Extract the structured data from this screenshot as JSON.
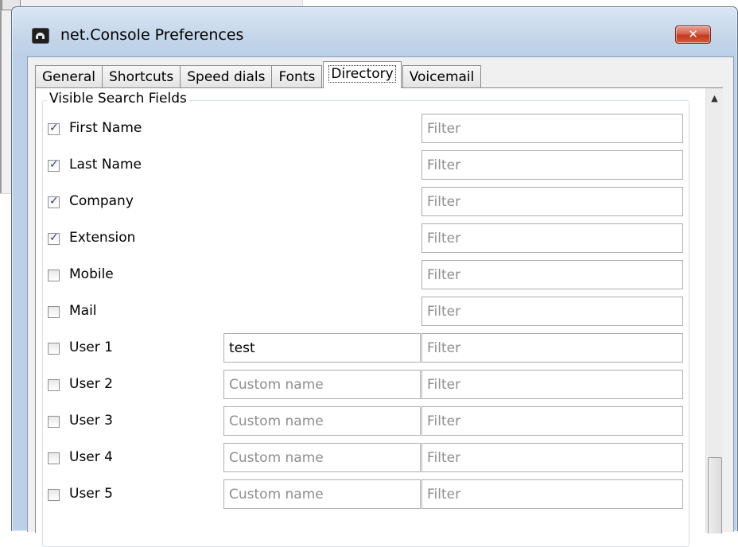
{
  "window": {
    "title": "net.Console Preferences",
    "close_label": "✕",
    "accent_color": "#bcd0e7",
    "close_color": "#c3391f"
  },
  "tabs": [
    {
      "label": "General",
      "active": false
    },
    {
      "label": "Shortcuts",
      "active": false
    },
    {
      "label": "Speed dials",
      "active": false
    },
    {
      "label": "Fonts",
      "active": false
    },
    {
      "label": "Directory",
      "active": true
    },
    {
      "label": "Voicemail",
      "active": false
    }
  ],
  "group": {
    "title": "Visible Search Fields",
    "rows": [
      {
        "label": "First Name",
        "checked": true,
        "filter_placeholder": "Filter"
      },
      {
        "label": "Last Name",
        "checked": true,
        "filter_placeholder": "Filter"
      },
      {
        "label": "Company",
        "checked": true,
        "filter_placeholder": "Filter"
      },
      {
        "label": "Extension",
        "checked": true,
        "filter_placeholder": "Filter"
      },
      {
        "label": "Mobile",
        "checked": false,
        "filter_placeholder": "Filter"
      },
      {
        "label": "Mail",
        "checked": false,
        "filter_placeholder": "Filter"
      },
      {
        "label": "User 1",
        "checked": false,
        "custom_name_value": "test",
        "custom_name_placeholder": "Custom name",
        "filter_placeholder": "Filter"
      },
      {
        "label": "User 2",
        "checked": false,
        "custom_name_value": "",
        "custom_name_placeholder": "Custom name",
        "filter_placeholder": "Filter"
      },
      {
        "label": "User 3",
        "checked": false,
        "custom_name_value": "",
        "custom_name_placeholder": "Custom name",
        "filter_placeholder": "Filter"
      },
      {
        "label": "User 4",
        "checked": false,
        "custom_name_value": "",
        "custom_name_placeholder": "Custom name",
        "filter_placeholder": "Filter"
      },
      {
        "label": "User 5",
        "checked": false,
        "custom_name_value": "",
        "custom_name_placeholder": "Custom name",
        "filter_placeholder": "Filter"
      }
    ]
  },
  "scrollbar": {
    "up_arrow_icon": "triangle-up-icon",
    "position": "bottom"
  }
}
